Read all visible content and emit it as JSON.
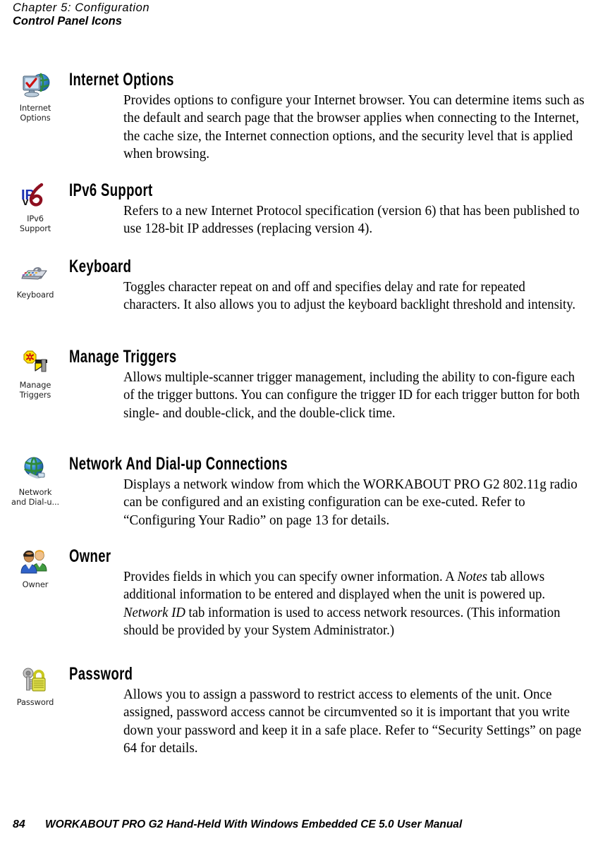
{
  "running_head": {
    "chapter": "Chapter  5:  Configuration",
    "section": "Control Panel Icons"
  },
  "entries": [
    {
      "icon_name": "internet-options-icon",
      "icon_caption_line1": "Internet",
      "icon_caption_line2": "Options",
      "title": "Internet Options",
      "text_html": "Provides options to configure your Internet browser. You can determine items such as the default and search page that the browser applies when connecting to the Internet, the cache size, the Internet connection options, and the security level that is applied when browsing."
    },
    {
      "icon_name": "ipv6-support-icon",
      "icon_caption_line1": "IPv6",
      "icon_caption_line2": "Support",
      "title": "IPv6 Support",
      "text_html": "Refers to a new Internet Protocol specification (version 6) that has been published to use 128-bit IP addresses (replacing version 4)."
    },
    {
      "icon_name": "keyboard-icon",
      "icon_caption_line1": "Keyboard",
      "icon_caption_line2": "",
      "title": "Keyboard",
      "text_html": "Toggles character repeat on and off and specifies delay and rate for repeated characters. It also allows you to adjust the keyboard backlight threshold and intensity."
    },
    {
      "icon_name": "manage-triggers-icon",
      "icon_caption_line1": "Manage",
      "icon_caption_line2": "Triggers",
      "title": "Manage Triggers",
      "text_html": "Allows multiple-scanner trigger management, including the ability to con-figure each of the trigger buttons. You can configure the trigger ID for each trigger button for both single- and double-click, and the double-click time."
    },
    {
      "icon_name": "network-dialup-icon",
      "icon_caption_line1": "Network",
      "icon_caption_line2": "and Dial-u...",
      "title": "Network And Dial-up Connections",
      "text_html": "Displays a network window from which the WORKABOUT PRO G2 802.11g radio can be configured and an existing configuration can be exe-cuted. Refer to “Configuring Your Radio” on page 13 for details."
    },
    {
      "icon_name": "owner-icon",
      "icon_caption_line1": "Owner",
      "icon_caption_line2": "",
      "title": "Owner",
      "text_html": "Provides fields in which you can specify owner information. A <i>Notes</i> tab allows additional information to be entered and displayed when the unit is powered up. <i>Network ID</i> tab information is used to access network resources. (This information should be provided by your System Administrator.)"
    },
    {
      "icon_name": "password-icon",
      "icon_caption_line1": "Password",
      "icon_caption_line2": "",
      "title": "Password",
      "text_html": "Allows you to assign a password to restrict access to elements of the unit. Once assigned, password access cannot be circumvented so it is important that you write down your password and keep it in a safe place. Refer to “Security Settings” on page 64 for details."
    }
  ],
  "footer": {
    "page_number": "84",
    "manual_title": "WORKABOUT PRO G2 Hand-Held With Windows Embedded CE 5.0 User Manual"
  },
  "colors": {
    "text": "#000000",
    "globe_blue": "#2f7fd0",
    "globe_green": "#3f9a3f",
    "monitor_blue": "#bcd6ee",
    "check_red": "#d02020",
    "ip_blue": "#1a3fc4",
    "six_red": "#8b1020",
    "trigger_yellow": "#ffe000",
    "lock_yellow": "#dede30",
    "key_gray": "#b8b8b8",
    "person_shirt_blue": "#2f62c8",
    "person_shirt_green": "#3f9a3f",
    "person_hair_dark": "#2a2018",
    "person_hair_orange": "#e8a020"
  }
}
